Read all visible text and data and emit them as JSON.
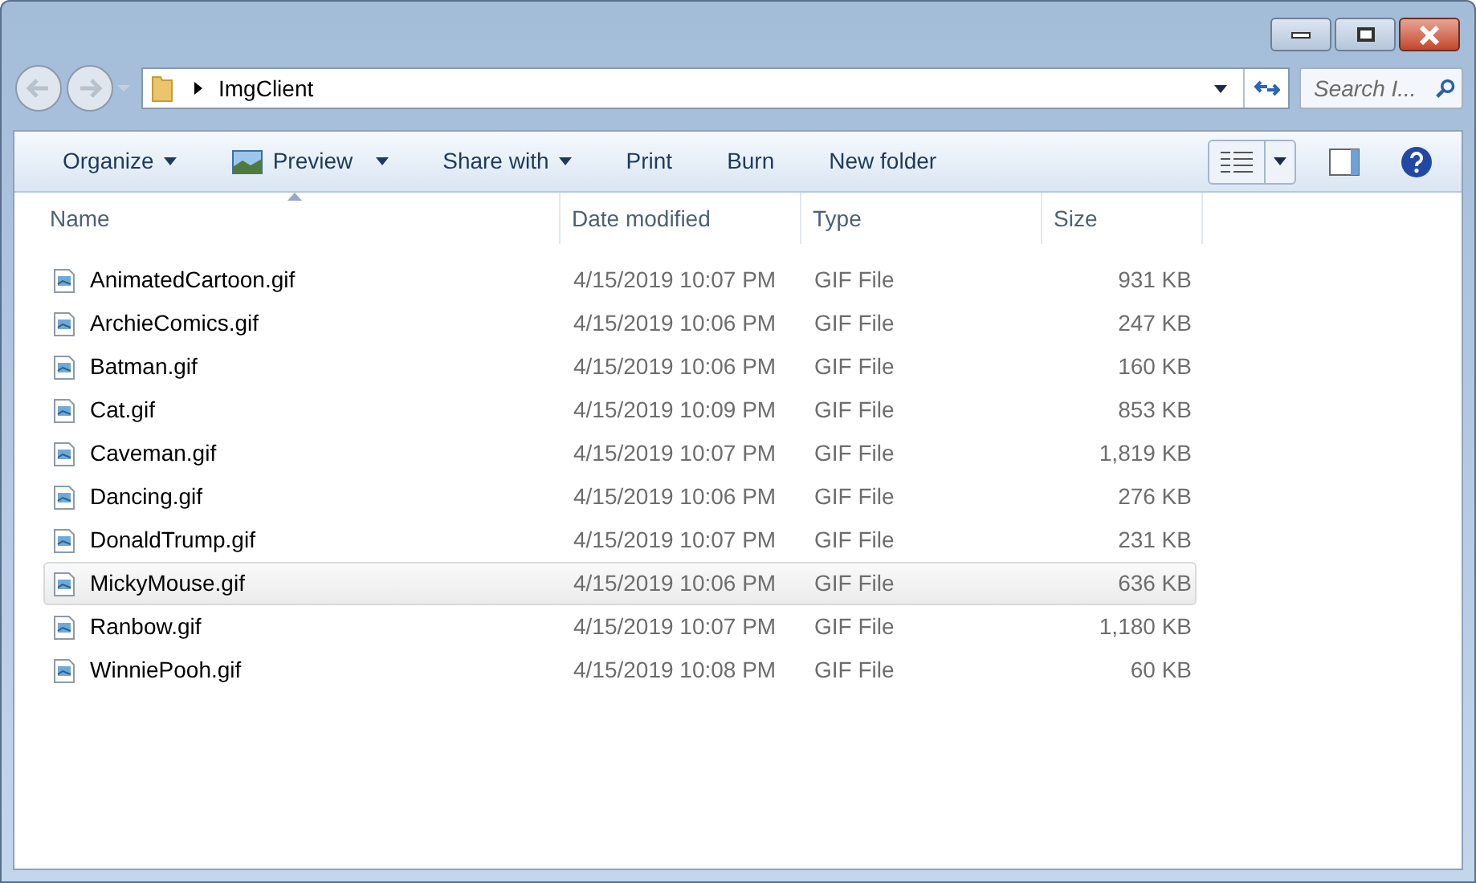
{
  "address_bar": {
    "path": "ImgClient"
  },
  "search": {
    "placeholder": "Search I..."
  },
  "toolbar": [
    {
      "label": "Organize",
      "dropdown": true,
      "kind": "menu"
    },
    {
      "label": "Preview",
      "dropdown": true,
      "kind": "preview"
    },
    {
      "label": "Share with",
      "dropdown": true,
      "kind": "menu"
    },
    {
      "label": "Print",
      "dropdown": false,
      "kind": "menu"
    },
    {
      "label": "Burn",
      "dropdown": false,
      "kind": "menu"
    },
    {
      "label": "New folder",
      "dropdown": false,
      "kind": "menu"
    }
  ],
  "columns": [
    "Name",
    "Date modified",
    "Type",
    "Size"
  ],
  "files": [
    {
      "name": "AnimatedCartoon.gif",
      "date": "4/15/2019 10:07 PM",
      "type": "GIF File",
      "size": "931 KB",
      "hovered": false
    },
    {
      "name": "ArchieComics.gif",
      "date": "4/15/2019 10:06 PM",
      "type": "GIF File",
      "size": "247 KB",
      "hovered": false
    },
    {
      "name": "Batman.gif",
      "date": "4/15/2019 10:06 PM",
      "type": "GIF File",
      "size": "160 KB",
      "hovered": false
    },
    {
      "name": "Cat.gif",
      "date": "4/15/2019 10:09 PM",
      "type": "GIF File",
      "size": "853 KB",
      "hovered": false
    },
    {
      "name": "Caveman.gif",
      "date": "4/15/2019 10:07 PM",
      "type": "GIF File",
      "size": "1,819 KB",
      "hovered": false
    },
    {
      "name": "Dancing.gif",
      "date": "4/15/2019 10:06 PM",
      "type": "GIF File",
      "size": "276 KB",
      "hovered": false
    },
    {
      "name": "DonaldTrump.gif",
      "date": "4/15/2019 10:07 PM",
      "type": "GIF File",
      "size": "231 KB",
      "hovered": false
    },
    {
      "name": "MickyMouse.gif",
      "date": "4/15/2019 10:06 PM",
      "type": "GIF File",
      "size": "636 KB",
      "hovered": true
    },
    {
      "name": "Ranbow.gif",
      "date": "4/15/2019 10:07 PM",
      "type": "GIF File",
      "size": "1,180 KB",
      "hovered": false
    },
    {
      "name": "WinniePooh.gif",
      "date": "4/15/2019 10:08 PM",
      "type": "GIF File",
      "size": "60 KB",
      "hovered": false
    }
  ]
}
